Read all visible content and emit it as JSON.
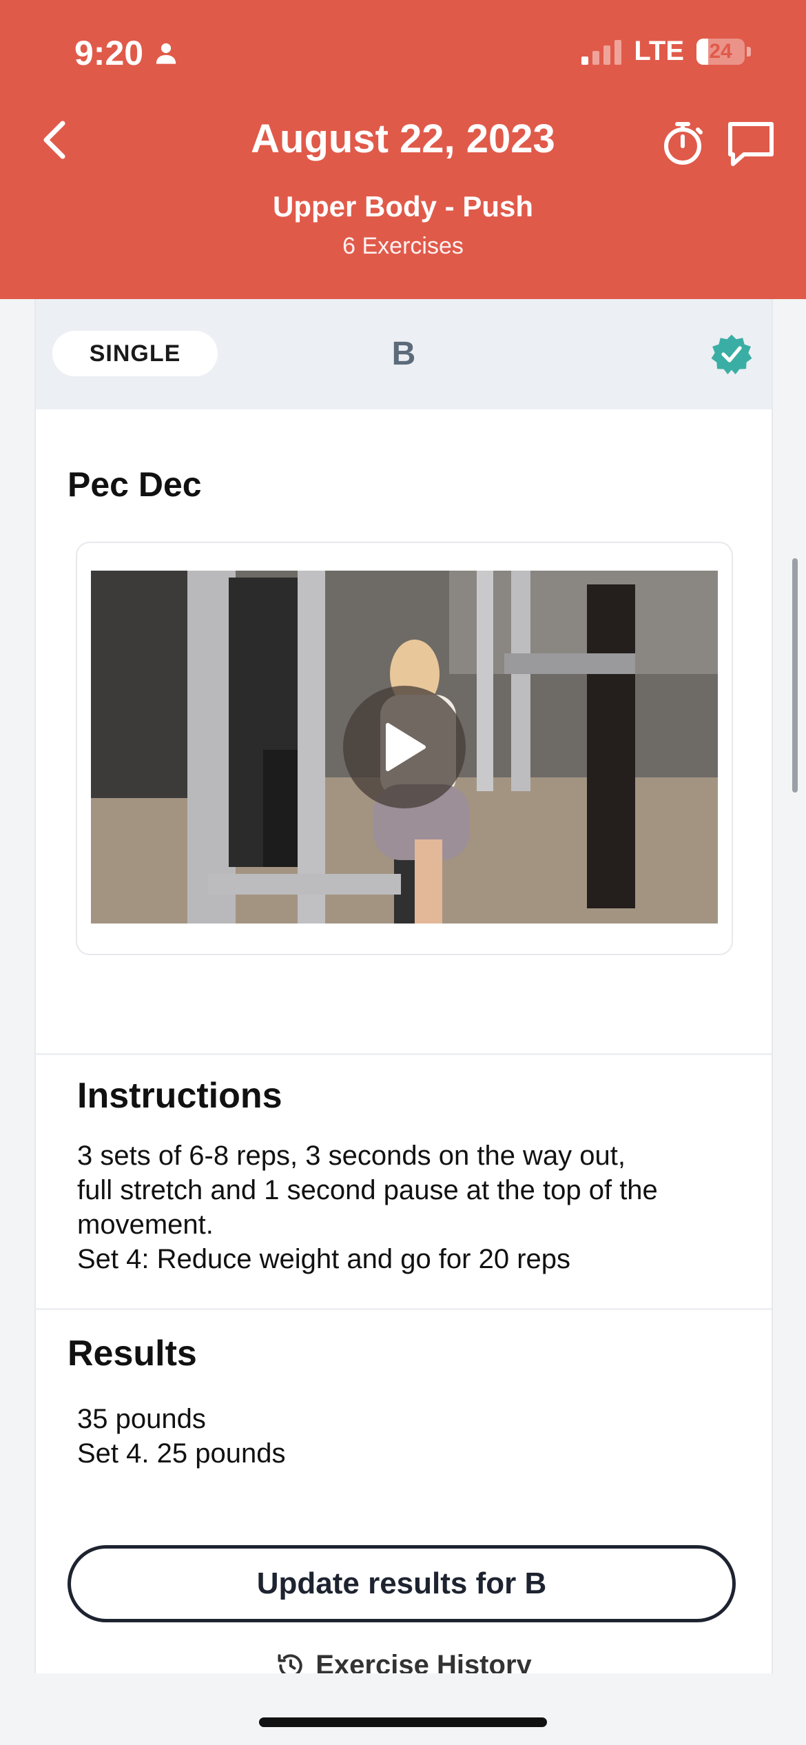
{
  "status_bar": {
    "time": "9:20",
    "network": "LTE",
    "battery": "24",
    "battery_level": 0.24
  },
  "header": {
    "title": "August 22, 2023",
    "subtitle": "Upper Body - Push",
    "exercise_count": "6 Exercises"
  },
  "block": {
    "type_label": "SINGLE",
    "letter": "B",
    "completed": true
  },
  "exercise": {
    "name": "Pec Dec"
  },
  "instructions": {
    "heading": "Instructions",
    "text": "3 sets of 6-8 reps, 3 seconds on the way out,\nfull stretch and 1 second pause at the top of the\nmovement.\nSet 4: Reduce weight and go for 20 reps"
  },
  "results": {
    "heading": "Results",
    "text": "35 pounds\nSet 4. 25 pounds"
  },
  "actions": {
    "update_label": "Update results for B",
    "history_label": "Exercise History"
  },
  "colors": {
    "brand": "#e05a4a",
    "check": "#3aaea4",
    "button_border": "#1e2330"
  },
  "icons": [
    "person-icon",
    "back-chevron-icon",
    "stopwatch-icon",
    "chat-icon",
    "check-badge-icon",
    "play-icon",
    "history-icon"
  ]
}
